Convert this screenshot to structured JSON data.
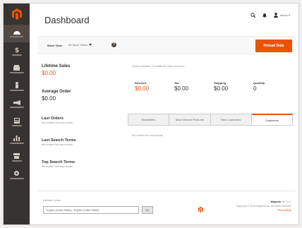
{
  "app": {
    "page_title": "Dashboard"
  },
  "colors": {
    "accent": "#eb5202",
    "sidebar": "#373330",
    "sidebar_active": "#514943"
  },
  "sidebar": {
    "logo_icon": "magento-logo-icon",
    "items": [
      {
        "icon": "dashboard-icon",
        "label": "DASHBOARD",
        "active": true
      },
      {
        "icon": "dollar-icon",
        "active": false
      },
      {
        "icon": "catalog-box-icon",
        "active": false
      },
      {
        "icon": "person-icon",
        "active": false
      },
      {
        "icon": "megaphone-icon",
        "active": false
      },
      {
        "icon": "content-grid-icon",
        "active": false
      },
      {
        "icon": "reports-bar-chart-icon",
        "active": false
      },
      {
        "icon": "stores-icon",
        "active": false
      },
      {
        "icon": "system-gear-icon",
        "active": false
      }
    ]
  },
  "header": {
    "search_icon": "search-icon",
    "notifications_icon": "bell-icon",
    "user_icon": "user-icon",
    "user_name": "admin ▾"
  },
  "toolbar": {
    "scope_label": "Store View:",
    "scope_value": "All Store Views",
    "help_icon": "?",
    "reload_label": "Reload Data"
  },
  "stats": {
    "lifetime_sales_label": "Lifetime Sales",
    "lifetime_sales_value": "$0.00",
    "average_order_label": "Average Order",
    "average_order_value": "$0.00"
  },
  "sections": {
    "last_orders_title": "Last Orders",
    "last_orders_note": "We couldn't find any records.",
    "last_search_title": "Last Search Terms",
    "last_search_note": "We couldn't find any records.",
    "top_search_title": "Top Search Terms",
    "top_search_note": "We couldn't find any records."
  },
  "chart_notice": "Chart is disabled. To enable the chart, click here.",
  "totals": [
    {
      "label": "Revenue",
      "value": "$0.00"
    },
    {
      "label": "Tax",
      "value": "$0.00"
    },
    {
      "label": "Shipping",
      "value": "$0.00"
    },
    {
      "label": "Quantity",
      "value": "0"
    }
  ],
  "tabs": [
    {
      "label": "Bestsellers",
      "active": false
    },
    {
      "label": "Most Viewed Products",
      "active": false
    },
    {
      "label": "New Customers",
      "active": false
    },
    {
      "label": "Customers",
      "active": true
    }
  ],
  "tab_content": {
    "empty_text": "We couldn't find any records."
  },
  "footer": {
    "language_label": "Interface Locale",
    "language_value": "English (United States) / English (United States)",
    "language_button": "Go",
    "brand": "Magento",
    "version": "ver. 2.x.x",
    "copyright": "Copyright © 2016 Magento Inc. All rights reserved.",
    "report_link": "Report Bugs"
  }
}
